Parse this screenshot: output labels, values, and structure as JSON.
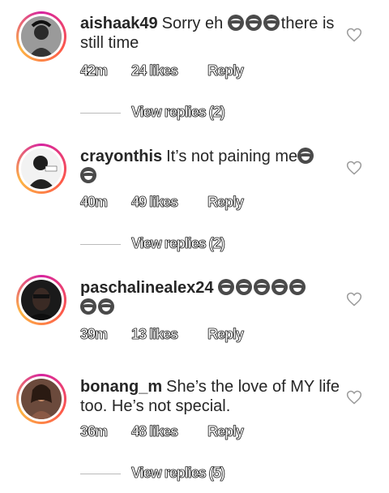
{
  "comments": [
    {
      "username": "aishaak49",
      "text_before": "Sorry eh",
      "text_after": "there is still time",
      "time": "42m",
      "likes": "24 likes",
      "reply": "Reply",
      "view_replies": "View replies (2)"
    },
    {
      "username": "crayonthis",
      "text_before": "It’s not paining me",
      "text_after": "",
      "time": "40m",
      "likes": "49 likes",
      "reply": "Reply",
      "view_replies": "View replies (2)"
    },
    {
      "username": "paschalinealex24",
      "text_before": "",
      "text_after": "",
      "time": "39m",
      "likes": "13 likes",
      "reply": "Reply",
      "view_replies": ""
    },
    {
      "username": "bonang_m",
      "text_before": "She’s the love of MY life too. He’s not special.",
      "text_after": "",
      "time": "36m",
      "likes": "48 likes",
      "reply": "Reply",
      "view_replies": "View replies (5)"
    }
  ],
  "icons": {
    "like": "heart-outline-icon",
    "emoji": "tears-of-joy-emoji"
  },
  "colors": {
    "story_ring": "#d6249f",
    "text": "#262626",
    "heart": "#9a9a9a"
  }
}
